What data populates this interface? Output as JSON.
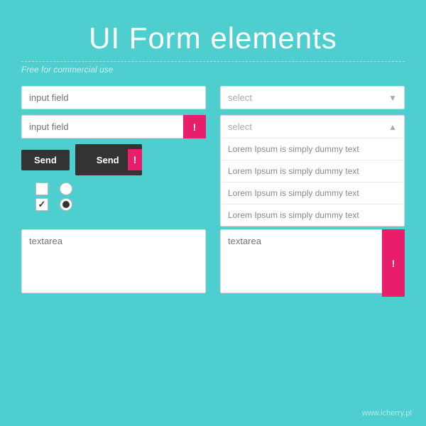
{
  "page": {
    "title": "UI Form elements",
    "subtitle": "Free for commercial use",
    "footer_url": "www.icherry.pl"
  },
  "left": {
    "input1_placeholder": "input field",
    "input2_placeholder": "input field",
    "error_icon": "!",
    "btn1_label": "Send",
    "btn2_label": "Send",
    "textarea_placeholder": "textarea"
  },
  "right": {
    "select_placeholder": "select",
    "dropdown_placeholder": "select",
    "dropdown_items": [
      "Lorem Ipsum is simply dummy text",
      "Lorem Ipsum is simply dummy text",
      "Lorem Ipsum is simply dummy text",
      "Lorem Ipsum is simply dummy text"
    ],
    "textarea_placeholder": "textarea",
    "error_icon": "!"
  }
}
